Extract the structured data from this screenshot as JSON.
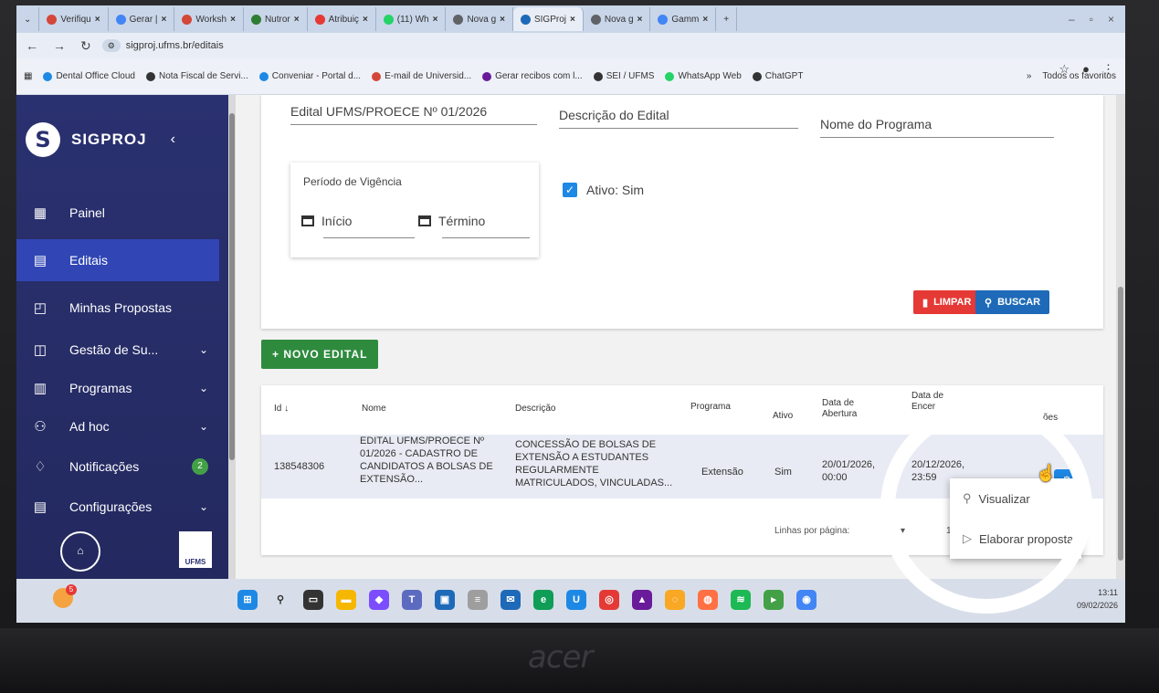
{
  "browser": {
    "tabs": [
      {
        "label": "Verifiqu",
        "color": "#d44638",
        "icon": "gmail-icon"
      },
      {
        "label": "Gerar |",
        "color": "#4285f4",
        "icon": "google-icon"
      },
      {
        "label": "Worksh",
        "color": "#d44638",
        "icon": "gmail-icon"
      },
      {
        "label": "Nutror",
        "color": "#2e7d32",
        "icon": "nutror-icon"
      },
      {
        "label": "Atribuiç",
        "color": "#e53935",
        "icon": "record-icon"
      },
      {
        "label": "(11) Wh",
        "color": "#25d366",
        "icon": "whatsapp-icon"
      },
      {
        "label": "Nova g",
        "color": "#5f6368",
        "icon": "chatgpt-icon"
      },
      {
        "label": "SIGProj",
        "color": "#1e6ab8",
        "icon": "sigproj-icon",
        "active": true
      },
      {
        "label": "Nova g",
        "color": "#5f6368",
        "icon": "chatgpt-icon"
      },
      {
        "label": "Gamm",
        "color": "#4285f4",
        "icon": "google-icon"
      }
    ],
    "new_tab": "+",
    "url": "sigproj.ufms.br/editais",
    "bookmarks": [
      {
        "label": "Dental Office Cloud",
        "color": "#1e88e5"
      },
      {
        "label": "Nota Fiscal de Servi...",
        "color": "#333"
      },
      {
        "label": "Conveniar - Portal d...",
        "color": "#1e88e5"
      },
      {
        "label": "E-mail de Universid...",
        "color": "#d44638"
      },
      {
        "label": "Gerar recibos com l...",
        "color": "#6a1b9a"
      },
      {
        "label": "SEI / UFMS",
        "color": "#333"
      },
      {
        "label": "WhatsApp Web",
        "color": "#25d366"
      },
      {
        "label": "ChatGPT",
        "color": "#333"
      }
    ],
    "bookmarks_more": "»",
    "all_bookmarks": "Todos os favoritos"
  },
  "sidebar": {
    "app_name": "SIGPROJ",
    "items": [
      {
        "label": "Painel",
        "icon": "dashboard-icon",
        "glyph": "▦"
      },
      {
        "label": "Editais",
        "icon": "document-icon",
        "glyph": "▤",
        "active": true
      },
      {
        "label": "Minhas Propostas",
        "icon": "proposals-icon",
        "glyph": "◰"
      },
      {
        "label": "Gestão de Su...",
        "icon": "management-icon",
        "glyph": "◫",
        "chevron": true
      },
      {
        "label": "Programas",
        "icon": "programs-icon",
        "glyph": "▥",
        "chevron": true
      },
      {
        "label": "Ad hoc",
        "icon": "people-icon",
        "glyph": "⚇",
        "chevron": true
      },
      {
        "label": "Notificações",
        "icon": "bell-icon",
        "glyph": "♢",
        "badge": "2"
      },
      {
        "label": "Configurações",
        "icon": "settings-icon",
        "glyph": "▤",
        "chevron": true
      }
    ],
    "footer_logo": "UFMS"
  },
  "filters": {
    "edital": "Edital UFMS/PROECE Nº 01/2026",
    "descricao": "Descrição do Edital",
    "programa": "Nome do Programa",
    "periodo_label": "Período de Vigência",
    "inicio": "Início",
    "termino": "Término",
    "ativo": "Ativo: Sim",
    "limpar": "LIMPAR",
    "buscar": "BUSCAR",
    "novo": "+ NOVO EDITAL"
  },
  "table": {
    "headers": {
      "id": "Id ↓",
      "nome": "Nome",
      "descricao": "Descrição",
      "programa": "Programa",
      "ativo": "Ativo",
      "abertura": "Data de Abertura",
      "encerramento": "Data de Encer",
      "acoes": "ões"
    },
    "rows": [
      {
        "id": "138548306",
        "nome": "EDITAL UFMS/PROECE Nº 01/2026 - CADASTRO DE CANDIDATOS A BOLSAS DE EXTENSÃO...",
        "descricao": "CONCESSÃO DE BOLSAS DE EXTENSÃO A ESTUDANTES REGULARMENTE MATRICULADOS, VINCULADAS...",
        "programa": "Extensão",
        "ativo": "Sim",
        "abertura": "20/01/2026, 00:00",
        "encerramento": "20/12/2026, 23:59"
      }
    ],
    "rows_per_page": "Linhas por página:",
    "page_size": "1"
  },
  "action_menu": {
    "visualizar": "Visualizar",
    "elaborar": "Elaborar proposta"
  },
  "taskbar": {
    "notif_count": "5",
    "time": "13:11",
    "date": "09/02/2026"
  },
  "laptop_brand": "acer"
}
